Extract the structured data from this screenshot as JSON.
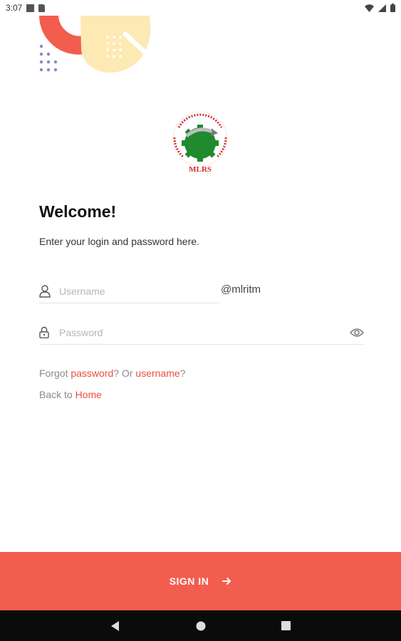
{
  "status": {
    "time": "3:07"
  },
  "header": {
    "title": "Welcome!",
    "subtitle": "Enter your login and password here."
  },
  "logo": {
    "text": "MLRS",
    "motto": "EMPOWERING THROUGH INNOVATIONS"
  },
  "form": {
    "username_placeholder": "Username",
    "username_value": "",
    "domain_suffix": "@mlritm",
    "password_placeholder": "Password",
    "password_value": ""
  },
  "links": {
    "forgot_prefix": "Forgot ",
    "password_link": "password",
    "or_text": "? Or ",
    "username_link": "username",
    "suffix": "?",
    "back_prefix": "Back to ",
    "home_link": "Home"
  },
  "signin": {
    "label": "SIGN IN"
  },
  "colors": {
    "accent": "#f25d4e",
    "link": "#e84e40",
    "deco_yellow": "#fde9b3"
  },
  "icons": [
    "signal-icon",
    "battery-icon",
    "user-icon",
    "lock-icon",
    "eye-icon",
    "arrow-right-icon",
    "back-icon",
    "home-icon",
    "recents-icon"
  ]
}
